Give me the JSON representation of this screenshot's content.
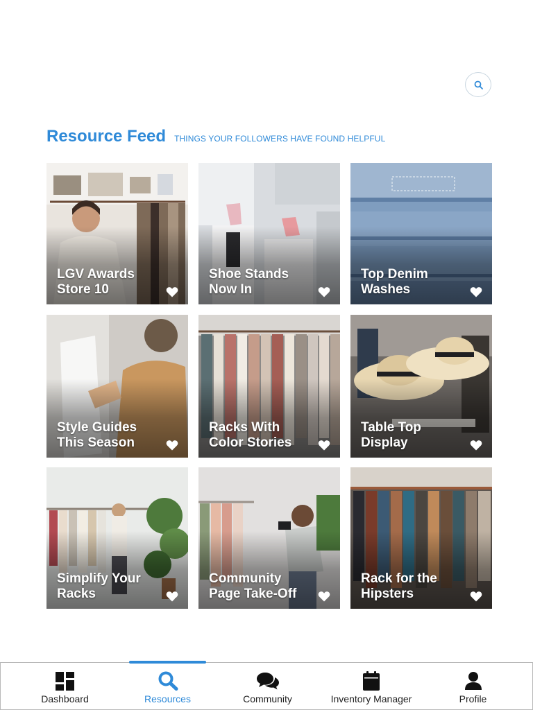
{
  "header": {
    "search_icon": "search-icon",
    "title": "Resource Feed",
    "subtitle": "THINGS YOUR FOLLOWERS HAVE FOUND HELPFUL"
  },
  "colors": {
    "accent": "#2f8ad8",
    "text": "#222222",
    "card_text": "#ffffff"
  },
  "cards": [
    {
      "line1": "LGV Awards",
      "line2": "Store 10",
      "icon": "heart-icon"
    },
    {
      "line1": "Shoe Stands",
      "line2": "Now In",
      "icon": "heart-icon"
    },
    {
      "line1": "Top Denim",
      "line2": "Washes",
      "icon": "heart-icon"
    },
    {
      "line1": "Style Guides",
      "line2": "This Season",
      "icon": "heart-icon"
    },
    {
      "line1": "Racks With",
      "line2": "Color Stories",
      "icon": "heart-icon"
    },
    {
      "line1": "Table Top",
      "line2": "Display",
      "icon": "heart-icon"
    },
    {
      "line1": "Simplify Your",
      "line2": "Racks",
      "icon": "heart-icon"
    },
    {
      "line1": "Community",
      "line2": "Page Take-Off",
      "icon": "heart-icon"
    },
    {
      "line1": "Rack for the",
      "line2": "Hipsters",
      "icon": "heart-icon"
    }
  ],
  "tabbar": {
    "active_tab": "Resources",
    "tabs": [
      {
        "label": "Dashboard",
        "icon": "dashboard-icon"
      },
      {
        "label": "Resources",
        "icon": "search-icon"
      },
      {
        "label": "Community",
        "icon": "chat-bubbles-icon"
      },
      {
        "label": "Inventory Manager",
        "icon": "calendar-icon"
      },
      {
        "label": "Profile",
        "icon": "user-icon"
      }
    ]
  }
}
